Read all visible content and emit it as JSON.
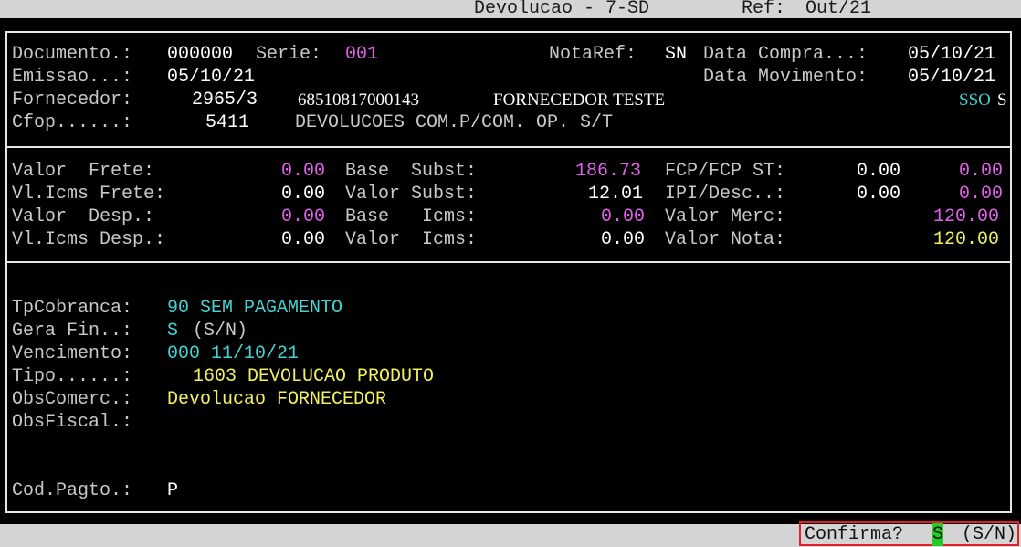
{
  "header": {
    "title": "Devolucao - 7-SD",
    "ref_label": "Ref:",
    "ref_value": "Out/21"
  },
  "document": {
    "documento_label": "Documento.:",
    "documento_value": "000000",
    "serie_label": "Serie:",
    "serie_value": "001",
    "notaref_label": "NotaRef:",
    "notaref_value": "SN",
    "data_compra_label": "Data Compra...:",
    "data_compra_value": "05/10/21",
    "emissao_label": "Emissao...:",
    "emissao_value": "05/10/21",
    "data_movimento_label": "Data Movimento:",
    "data_movimento_value": "05/10/21",
    "fornecedor_label": "Fornecedor:",
    "fornecedor_code": "2965/3",
    "fornecedor_cnpj": "68510817000143",
    "fornecedor_name": "FORNECEDOR TESTE",
    "flags_c": "SSO",
    "flags_w": "S",
    "cfop_label": "Cfop......:",
    "cfop_value": "5411",
    "cfop_desc": "DEVOLUCOES COM.P/COM. OP. S/T"
  },
  "values": {
    "valor_frete_label": "Valor  Frete:",
    "valor_frete": "0.00",
    "vl_icms_frete_label": "Vl.Icms Frete:",
    "vl_icms_frete": "0.00",
    "valor_desp_label": "Valor  Desp.:",
    "valor_desp": "0.00",
    "vl_icms_desp_label": "Vl.Icms Desp.:",
    "vl_icms_desp": "0.00",
    "base_subst_label": "Base  Subst:",
    "base_subst": "186.73",
    "valor_subst_label": "Valor Subst:",
    "valor_subst": "12.01",
    "base_icms_label": "Base   Icms:",
    "base_icms": "0.00",
    "valor_icms_label": "Valor  Icms:",
    "valor_icms": "0.00",
    "fcp_label": "FCP/FCP ST:",
    "fcp_a": "0.00",
    "fcp_b": "0.00",
    "ipi_label": "IPI/Desc..:",
    "ipi_a": "0.00",
    "ipi_b": "0.00",
    "valor_merc_label": "Valor Merc:",
    "valor_merc": "120.00",
    "valor_nota_label": "Valor Nota:",
    "valor_nota": "120.00"
  },
  "billing": {
    "tpcobranca_label": "TpCobranca:",
    "tpcobranca_value": "90 SEM PAGAMENTO",
    "gera_fin_label": "Gera Fin..:",
    "gera_fin_value": "S",
    "gera_fin_hint": "(S/N)",
    "vencimento_label": "Vencimento:",
    "vencimento_value": "000 11/10/21",
    "tipo_label": "Tipo......:",
    "tipo_value": "1603 DEVOLUCAO PRODUTO",
    "obscomerc_label": "ObsComerc.:",
    "obscomerc_value": "Devolucao FORNECEDOR",
    "obsfiscal_label": "ObsFiscal.:",
    "obsfiscal_value": "",
    "codpagto_label": "Cod.Pagto.:",
    "codpagto_value": "P"
  },
  "prompt": {
    "label": "Confirma?",
    "answer": "S",
    "hint": "(S/N)"
  }
}
